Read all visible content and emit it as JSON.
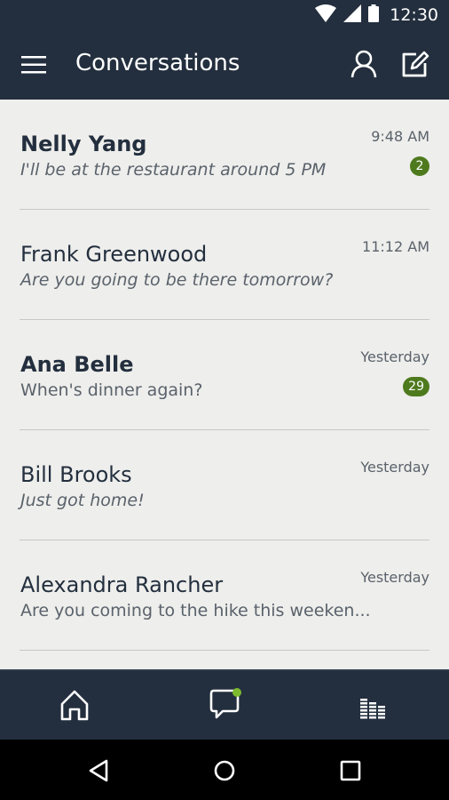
{
  "status_bar": {
    "time": "12:30"
  },
  "app_bar": {
    "title": "Conversations"
  },
  "conversations": [
    {
      "name": "Nelly Yang",
      "preview": "I'll be at the restaurant around 5 PM",
      "time": "9:48 AM",
      "badge": "2"
    },
    {
      "name": "Frank Greenwood",
      "preview": "Are you going to be there tomorrow?",
      "time": "11:12 AM"
    },
    {
      "name": "Ana Belle",
      "preview": "When's dinner again?",
      "time": "Yesterday",
      "badge": "29"
    },
    {
      "name": "Bill Brooks",
      "preview": "Just got home!",
      "time": "Yesterday"
    },
    {
      "name": "Alexandra Rancher",
      "preview": "Are you coming to the hike this weeken...",
      "time": "Yesterday"
    }
  ],
  "bottom_nav": {
    "items": [
      {
        "icon": "home-icon"
      },
      {
        "icon": "chat-bubble-icon",
        "has_notification": true
      },
      {
        "icon": "equalizer-icon"
      }
    ],
    "notification_color": "#7DBA2F"
  },
  "colors": {
    "header": "#232F3E",
    "background": "#EEEEEC",
    "badge": "#4E7A1E",
    "text_primary": "#232F3E",
    "text_secondary": "#5A626B"
  }
}
